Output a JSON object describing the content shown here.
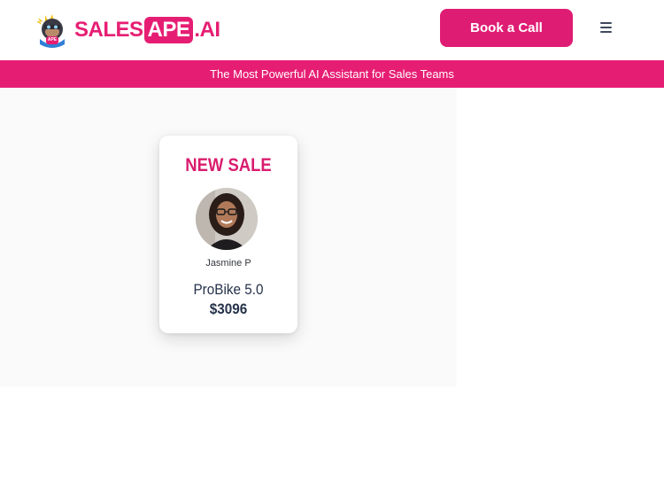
{
  "header": {
    "logo": {
      "part1": "SALES",
      "part2": "APE",
      "part3": ".AI",
      "mascot_badge": "APE",
      "icon": "ape-mascot-icon"
    },
    "cta_label": "Book a Call",
    "menu_icon": "hamburger-menu-icon"
  },
  "banner": {
    "text": "The Most Powerful AI Assistant for Sales Teams"
  },
  "sale_card": {
    "title": "NEW SALE",
    "person_name": "Jasmine P",
    "product": "ProBike 5.0",
    "price": "$3096"
  },
  "colors": {
    "brand_pink": "#e61e73",
    "text_dark": "#25324a",
    "hero_bg": "#fafafa"
  }
}
